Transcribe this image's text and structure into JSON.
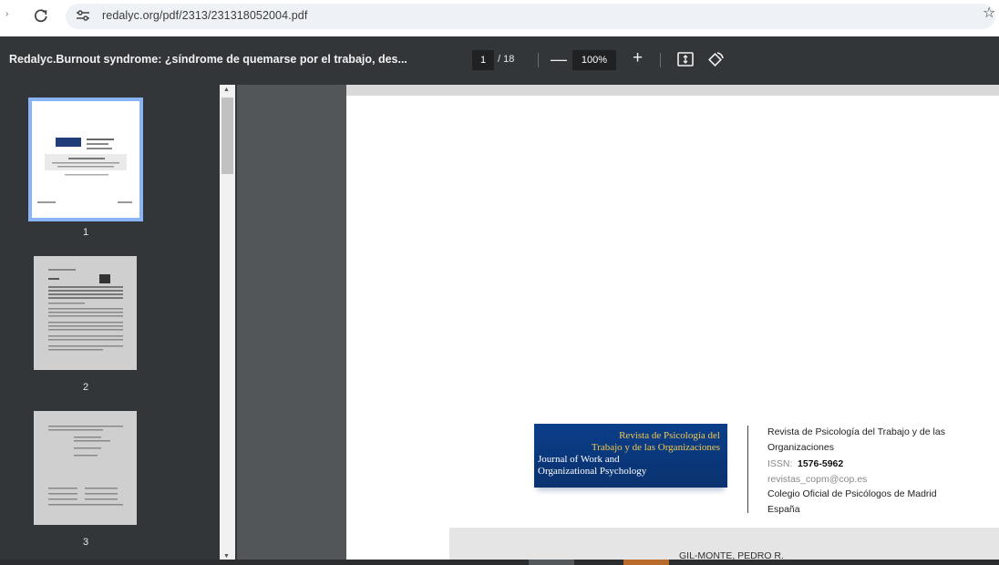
{
  "browser": {
    "url": "redalyc.org/pdf/2313/231318052004.pdf"
  },
  "toolbar": {
    "title": "Redalyc.Burnout syndrome: ¿síndrome de quemarse por el trabajo, des...",
    "current_page": "1",
    "total_pages": "/ 18",
    "zoom": "100%",
    "zoom_out_label": "—",
    "zoom_in_label": "+"
  },
  "sidebar": {
    "thumbnails": [
      {
        "label": "1"
      },
      {
        "label": "2"
      },
      {
        "label": "3"
      }
    ]
  },
  "page": {
    "logo": {
      "line1": "Revista de Psicología del",
      "line2": "Trabajo y de las Organizaciones",
      "line3": "Journal of Work and",
      "line4": "Organizational Psychology"
    },
    "journal_name_1": "Revista de Psicología del Trabajo y de las",
    "journal_name_2": "Organizaciones",
    "issn_label": "ISSN:",
    "issn_value": "1576-5962",
    "email": "revistas_copm@cop.es",
    "publisher": "Colegio Oficial de Psicólogos de Madrid",
    "country": "España",
    "author": "GIL-MONTE, PEDRO R."
  },
  "icons": {
    "reload": "reload-icon",
    "site_settings": "tune-icon",
    "bookmark": "star-icon",
    "fit": "fit-to-page-icon",
    "rotate": "rotate-icon"
  },
  "colors": {
    "toolbar": "#323639",
    "viewer": "#525659",
    "thumb_highlight": "#8ab4f8",
    "logo_blue": "#0b3e8a",
    "logo_gold": "#f2c94c"
  }
}
